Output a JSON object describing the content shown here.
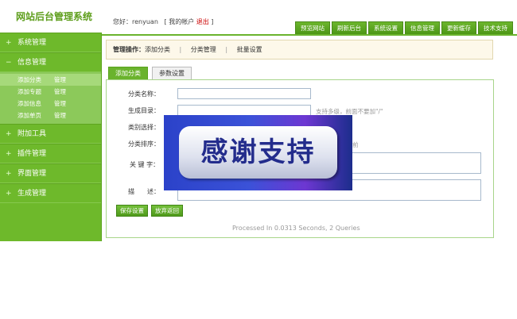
{
  "header": {
    "logo_text": "网站后台管理系统",
    "greeting": "您好：",
    "username": "renyuan",
    "account_open": "[",
    "account_label": "我的帐户",
    "logout_label": "退出",
    "account_close": "]",
    "top_links": [
      "预览网站",
      "刷新后台",
      "系统设置",
      "信息管理",
      "更新缓存",
      "技术支持"
    ]
  },
  "sidebar": {
    "sections": [
      {
        "label": "系统管理",
        "mark": "+"
      },
      {
        "label": "信息管理",
        "mark": "−"
      },
      {
        "label": "附加工具",
        "mark": "+"
      },
      {
        "label": "插件管理",
        "mark": "+"
      },
      {
        "label": "界面管理",
        "mark": "+"
      },
      {
        "label": "生成管理",
        "mark": "+"
      }
    ],
    "info_items": [
      {
        "name": "添加分类",
        "action": "管理"
      },
      {
        "name": "添加专题",
        "action": "管理"
      },
      {
        "name": "添加信息",
        "action": "管理"
      },
      {
        "name": "添加单页",
        "action": "管理"
      }
    ]
  },
  "crumb": {
    "prefix": "管理操作：",
    "item1": "添加分类",
    "sep": "|",
    "item2": "分类管理",
    "item3": "批量设置"
  },
  "tabs": [
    "添加分类",
    "参数设置"
  ],
  "form": {
    "labels": {
      "name": "分类名称：",
      "dir": "生成目录：",
      "type": "类别选择：",
      "order": "分类排序：",
      "keywords": "关 键 字：",
      "description": "描　　述："
    },
    "dir_hint": "支持多级，前面不要加\"/\"",
    "order_hint": "前",
    "save_button": "保存设置",
    "cancel_button": "放弃返回"
  },
  "footer": {
    "processed": "Processed In 0.0313 Seconds, 2 Queries"
  },
  "overlay": {
    "text": "感谢支持"
  },
  "colors": {
    "brand_green": "#6ab32d",
    "logout_red": "#cc0000",
    "overlay_blue": "#2b42c9"
  }
}
